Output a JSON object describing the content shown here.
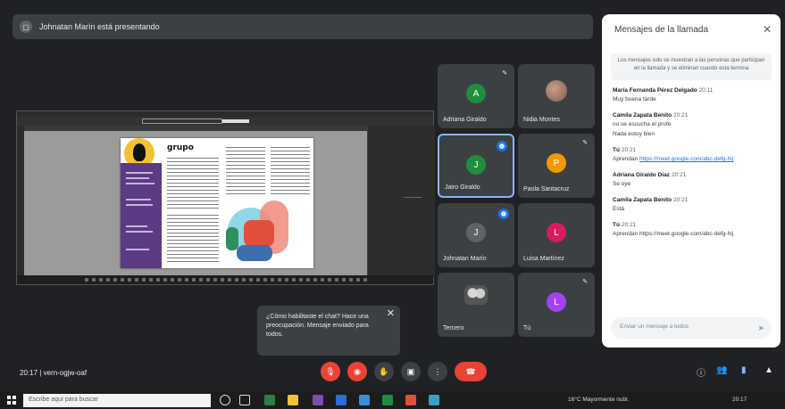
{
  "banner": {
    "text": "Johnatan Marín está presentando",
    "icon": "presentation-icon"
  },
  "shared_screen": {
    "doc_title": "grupo"
  },
  "participants": [
    {
      "initial": "A",
      "name": "Adriana Giraldo",
      "color": "#1e8e3e"
    },
    {
      "initial": "",
      "name": "Nidia Montes",
      "color": ""
    },
    {
      "initial": "J",
      "name": "Jairo Giraldo",
      "color": "#1e8e3e"
    },
    {
      "initial": "P",
      "name": "Paola Santacruz",
      "color": "#f29900"
    },
    {
      "initial": "J",
      "name": "Johnatan Marín",
      "color": "#5f6368"
    },
    {
      "initial": "L",
      "name": "Luisa Martínez",
      "color": "#d81b60"
    },
    {
      "initial": "",
      "name": "Tercero",
      "color": ""
    },
    {
      "initial": "L",
      "name": "Tú",
      "color": "#a142f4"
    }
  ],
  "chat": {
    "title": "Mensajes de la llamada",
    "notice": "Los mensajes solo se muestran a las personas que participan en la llamada y se eliminan cuando esta termina",
    "messages": [
      {
        "sender": "María Fernanda Pérez Delgado",
        "time": "20:11",
        "text": "Muy buena tarde"
      },
      {
        "sender": "Camila Zapata Benito",
        "time": "20:21",
        "text": "no se escucha el profe"
      },
      {
        "sender": "",
        "time": "",
        "text": "Nada estoy bien"
      },
      {
        "sender": "Tú",
        "time": "20:21",
        "text": "Aprendan",
        "link": "https://meet.google.com/abc-defg-hij"
      },
      {
        "sender": "Adriana Giraldo Díaz",
        "time": "20:21",
        "text": "Se oye"
      },
      {
        "sender": "Camila Zapata Benito",
        "time": "20:21",
        "text": "Está"
      },
      {
        "sender": "Tú",
        "time": "20:21",
        "text": "Aprendan https://meet.google.com/abc-defg-hij"
      }
    ],
    "input_placeholder": "Enviar un mensaje a todos"
  },
  "toast": {
    "text": "¿Cómo habilitaste el chat? Hace una preocupación. Mensaje enviado para todos."
  },
  "meeting": {
    "time": "20:17",
    "code": "vern-ogjw-oaf"
  },
  "taskbar": {
    "search_placeholder": "Escribe aquí para buscar",
    "weather": "16°C Mayormente nubl.",
    "clock": "20:17"
  }
}
